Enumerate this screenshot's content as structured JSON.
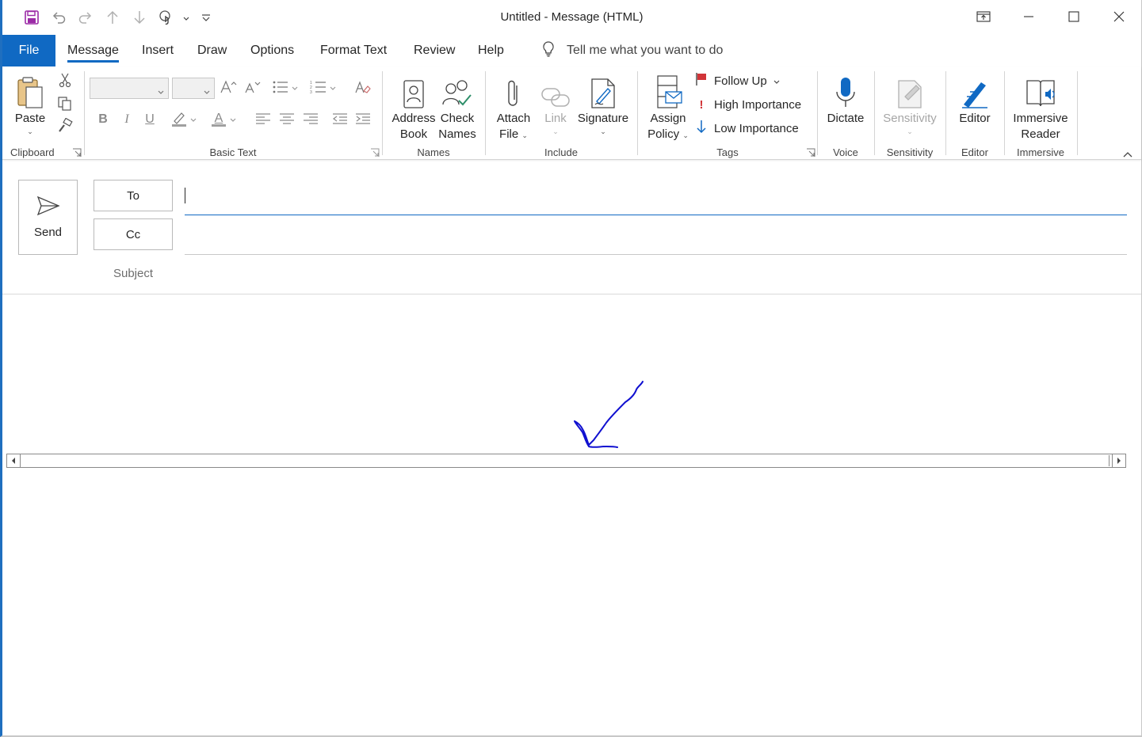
{
  "window": {
    "title": "Untitled  -  Message (HTML)"
  },
  "tabs": [
    {
      "label": "File"
    },
    {
      "label": "Message"
    },
    {
      "label": "Insert"
    },
    {
      "label": "Draw"
    },
    {
      "label": "Options"
    },
    {
      "label": "Format Text"
    },
    {
      "label": "Review"
    },
    {
      "label": "Help"
    }
  ],
  "active_tab": "Message",
  "tell_me": "Tell me what you want to do",
  "ribbon": {
    "clipboard": {
      "paste": "Paste",
      "label": "Clipboard"
    },
    "basic_text": {
      "label": "Basic Text",
      "bold": "B",
      "italic": "I",
      "underline": "U",
      "font_color": "A"
    },
    "names": {
      "address_book_1": "Address",
      "address_book_2": "Book",
      "check_names_1": "Check",
      "check_names_2": "Names",
      "label": "Names"
    },
    "include": {
      "attach_1": "Attach",
      "attach_2": "File",
      "link": "Link",
      "signature": "Signature",
      "label": "Include"
    },
    "tags": {
      "assign_1": "Assign",
      "assign_2": "Policy",
      "follow_up": "Follow Up",
      "high": "High Importance",
      "low": "Low Importance",
      "label": "Tags"
    },
    "voice": {
      "dictate": "Dictate",
      "label": "Voice"
    },
    "sensitivity": {
      "button": "Sensitivity",
      "label": "Sensitivity"
    },
    "editor": {
      "button": "Editor",
      "label": "Editor"
    },
    "immersive": {
      "button_1": "Immersive",
      "button_2": "Reader",
      "label": "Immersive"
    }
  },
  "compose": {
    "send": "Send",
    "to": "To",
    "cc": "Cc",
    "subject": "Subject",
    "to_value": "",
    "cc_value": "",
    "subject_value": ""
  },
  "colors": {
    "accent": "#1069c3",
    "ink": "#1010d0",
    "flag": "#d13438",
    "high_importance": "#d13438"
  }
}
